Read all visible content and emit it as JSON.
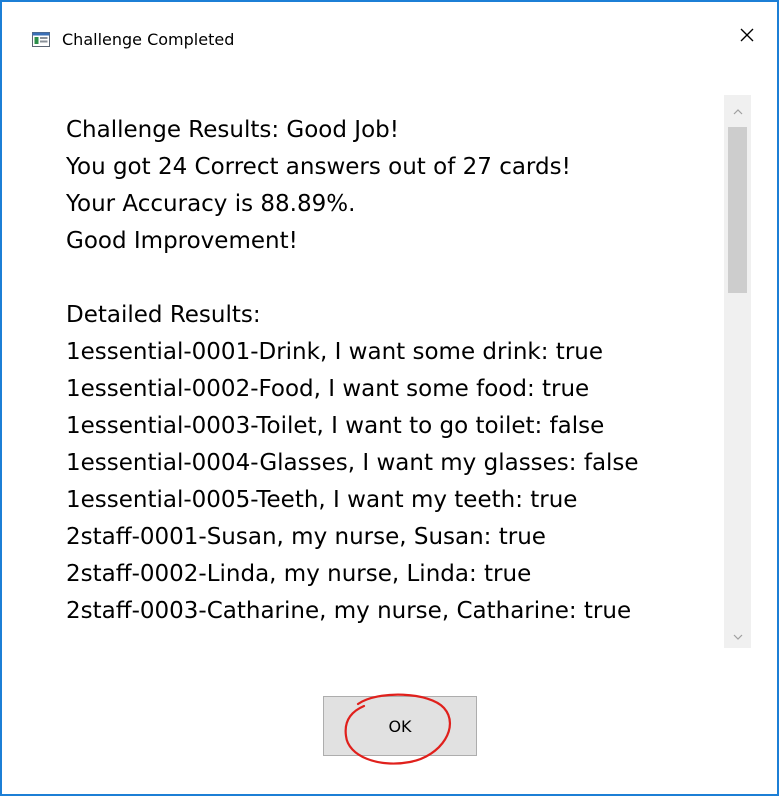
{
  "window": {
    "title": "Challenge Completed",
    "accent_color": "#1c7fd6"
  },
  "icons": {
    "app": "app-window-icon",
    "close": "close-icon",
    "scroll_up": "chevron-up-icon",
    "scroll_down": "chevron-down-icon"
  },
  "results": {
    "lines": [
      "Challenge Results: Good Job!",
      "You got 24 Correct answers out of 27 cards!",
      "Your Accuracy is 88.89%.",
      "Good Improvement!",
      "",
      "Detailed Results:",
      "1essential-0001-Drink, I want some drink: true",
      "1essential-0002-Food, I want some food: true",
      "1essential-0003-Toilet, I want to go toilet: false",
      "1essential-0004-Glasses, I want my glasses: false",
      "1essential-0005-Teeth, I want my teeth: true",
      "2staff-0001-Susan, my nurse, Susan: true",
      "2staff-0002-Linda, my nurse, Linda: true",
      "2staff-0003-Catharine, my nurse, Catharine: true"
    ]
  },
  "buttons": {
    "ok_label": "OK"
  },
  "annotation": {
    "circle_color": "#e0201c"
  }
}
